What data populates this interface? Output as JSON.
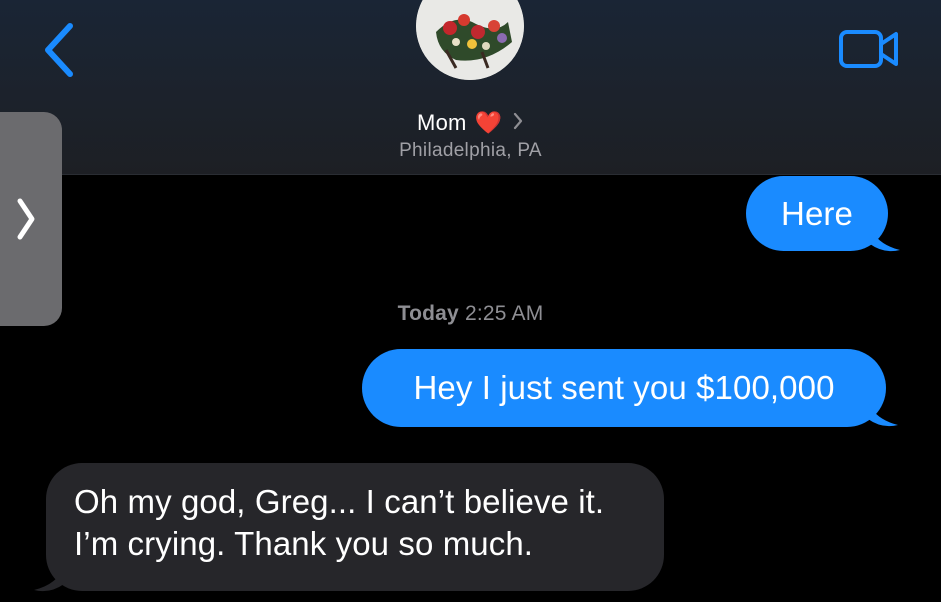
{
  "header": {
    "contact_name": "Mom",
    "contact_emoji": "❤️",
    "location": "Philadelphia, PA",
    "back_icon": "chevron-left-icon",
    "video_icon": "video-camera-icon"
  },
  "drawer": {
    "icon": "chevron-right-icon"
  },
  "messages": [
    {
      "direction": "sent",
      "text": "Here"
    },
    {
      "direction": "sent",
      "text": "Hey I just sent you $100,000"
    },
    {
      "direction": "received",
      "lines": [
        "Oh my god, Greg... I can’t believe it.",
        "I’m crying. Thank you so much."
      ]
    }
  ],
  "timestamp": {
    "day": "Today",
    "time": "2:25 AM"
  },
  "colors": {
    "accent": "#1a8bff",
    "received_bubble": "#26262a",
    "heart": "#e8262f"
  }
}
